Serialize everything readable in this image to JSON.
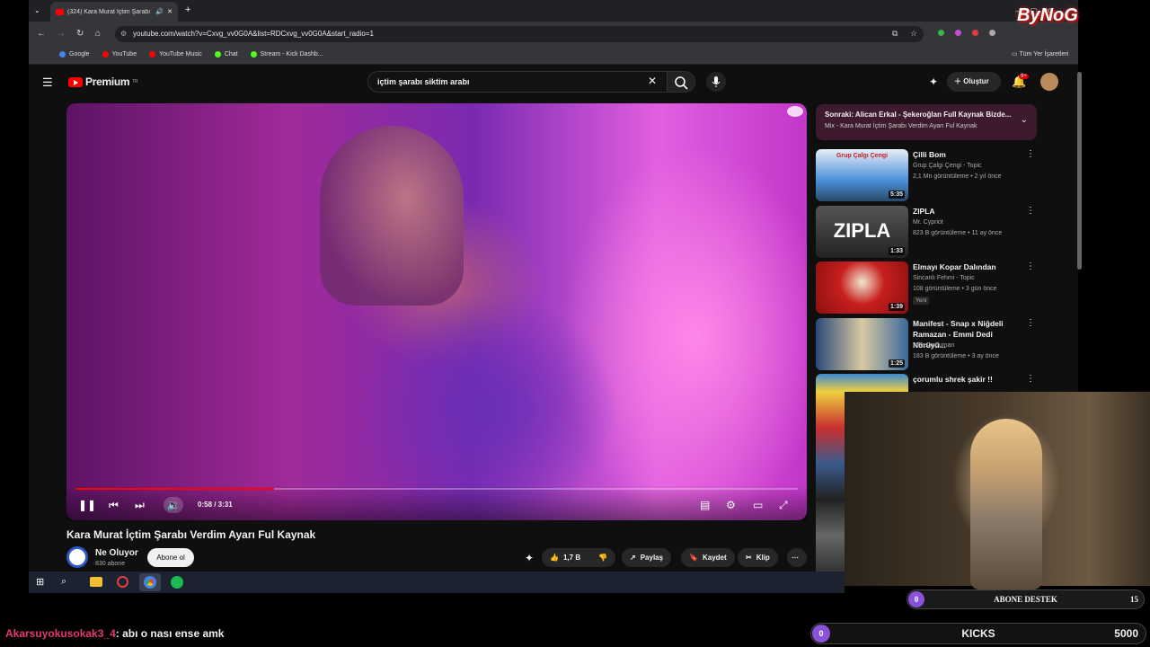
{
  "browser": {
    "tab_title": "(324) Kara Murat İçtim Şarabı",
    "url": "youtube.com/watch?v=Cxvg_vv0G0A&list=RDCxvg_vv0G0A&start_radio=1",
    "bookmarks": [
      "Google",
      "YouTube",
      "YouTube Music",
      "Chat",
      "Stream - Kick Dashb..."
    ],
    "all_bookmarks_label": "Tüm Yer İşaretleri"
  },
  "youtube": {
    "logo_text": "Premium",
    "logo_super": "TR",
    "search_value": "içtim şarabı siktim arabı",
    "create_label": "Oluştur",
    "notif_count": "9+"
  },
  "player": {
    "time": "0:58 / 3:31",
    "progress_fraction": 0.275,
    "title": "Kara Murat İçtim Şarabı Verdim Ayarı Ful Kaynak",
    "channel": "Ne Oluyor",
    "subscribers": "830 abone",
    "subscribe_label": "Abone ol",
    "likes": "1,7 B",
    "share_label": "Paylaş",
    "save_label": "Kaydet",
    "clip_label": "Klip"
  },
  "upnext": {
    "line1": "Sonraki: Alican Erkal - Şekeroğlan Full Kaynak Bizde...",
    "line2": "Mix - Kara Murat   İçtim Şarabı Verdim Ayarı Ful Kaynak"
  },
  "recommendations": [
    {
      "title": "Çilli Bom",
      "channel": "Grup Çalgı Çengi - Topic",
      "meta": "2,1 Mn görüntüleme • 2 yıl önce",
      "duration": "5:35",
      "thumb_text": "Grup Çalgı Çengi",
      "color": "#4a8fd8"
    },
    {
      "title": "ZIPLA",
      "channel": "Mr. Cypriot",
      "meta": "823 B görüntüleme • 11 ay önce",
      "duration": "1:33",
      "thumb_text": "ZIPLA",
      "color": "#333333"
    },
    {
      "title": "Elmayı Kopar Dalından",
      "channel": "Sincanlı Fehmi - Topic",
      "meta": "108 görüntüleme • 3 gün önce",
      "badge": "Yeni",
      "duration": "1:39",
      "thumb_text": "",
      "color": "#c81e1e"
    },
    {
      "title": "Manifest - Snap x Niğdeli Ramazan - Emmi Dedi Nörüyü...",
      "channel": "mhasanduman",
      "meta": "183 B görüntüleme • 3 ay önce",
      "duration": "1:25",
      "thumb_text": "",
      "color": "#3a6a9a"
    },
    {
      "title": "çorumlu shrek şakir !!",
      "channel": "",
      "meta": "",
      "duration": "",
      "thumb_text": "",
      "color": "#3d8ad0"
    }
  ],
  "overlay": {
    "abone_count": "0",
    "abone_label": "ABONE DESTEK",
    "abone_goal": "15",
    "kicks_count": "0",
    "kicks_label": "KICKS",
    "kicks_goal": "5000",
    "chat_user": "Akarsuyokusokak3_4",
    "chat_msg": ": abı o nası ense amk",
    "brand": "ByNoG"
  }
}
